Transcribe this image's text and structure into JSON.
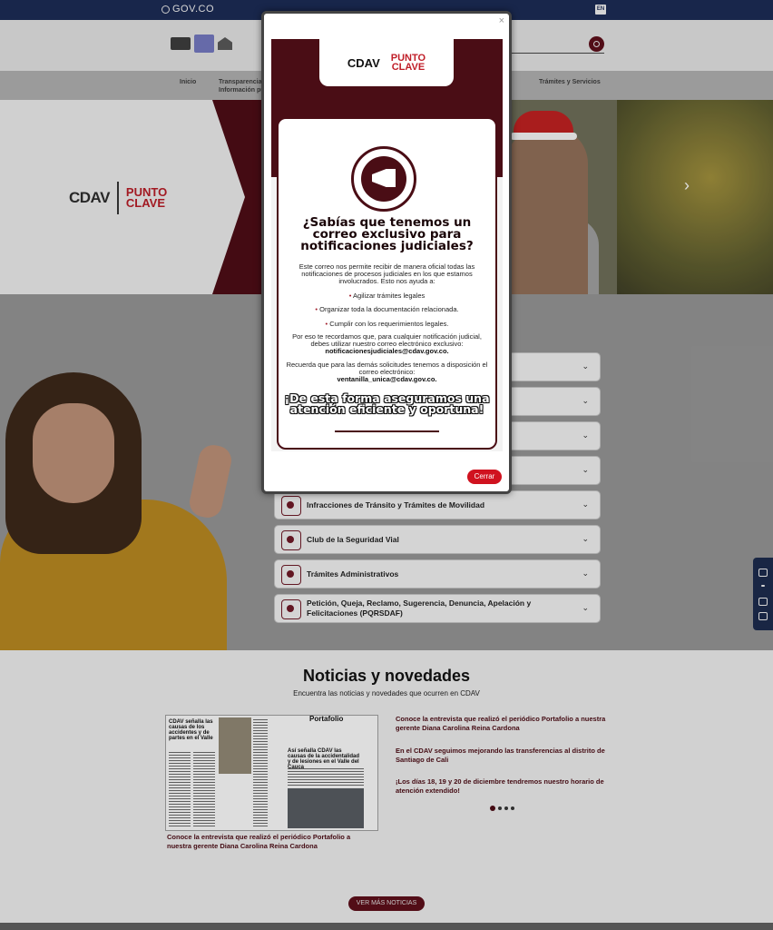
{
  "govbar": {
    "logo": "GOV.CO",
    "lang": "EN"
  },
  "nav": {
    "items": [
      {
        "label": "Inicio"
      },
      {
        "label": "Transparencia y"
      },
      {
        "label": "Información pú"
      },
      {
        "label": "Trámites y Servicios"
      }
    ]
  },
  "hero": {
    "brand_cdav": "CDAV",
    "brand_pc_1": "PUNTO",
    "brand_pc_2": "CLAVE"
  },
  "services": {
    "items": [
      {
        "label": ""
      },
      {
        "label": ""
      },
      {
        "label": ""
      },
      {
        "label": ""
      },
      {
        "label": "Infracciones de Tránsito y Trámites de Movilidad"
      },
      {
        "label": "Club de la Seguridad Vial"
      },
      {
        "label": "Trámites Administrativos"
      },
      {
        "label": "Petición, Queja, Reclamo, Sugerencia, Denuncia, Apelación y Felicitaciones (PQRSDAF)"
      }
    ]
  },
  "news": {
    "title": "Noticias y novedades",
    "subtitle": "Encuentra las noticias y novedades que ocurren en CDAV",
    "featured_caption": "Conoce la entrevista que realizó el periódico Portafolio a nuestra gerente Diana Carolina Reina Cardona",
    "paper_masthead": "Portafolio",
    "paper_headline_1": "CDAV señalla las causas de los accidentes y de partes en el Valle",
    "paper_headline_2": "Así señalla CDAV las causas de la accidentalidad y de lesiones en el Valle del Cauca",
    "links": [
      "Conoce la entrevista que realizó el periódico Portafolio a nuestra gerente Diana Carolina Reina Cardona",
      "En el CDAV seguimos mejorando las transferencias al distrito de Santiago de Cali",
      "¡Los días 18, 19 y 20 de diciembre tendremos nuestro horario de atención extendido!"
    ],
    "more_label": "VER MÁS NOTICIAS"
  },
  "modal": {
    "close_x": "×",
    "logo_cdav": "CDAV",
    "logo_pc_1": "PUNTO",
    "logo_pc_2": "CLAVE",
    "question": "¿Sabías que tenemos un correo exclusivo para notificaciones judiciales?",
    "intro": "Este correo nos permite recibir de manera oficial todas las notificaciones de procesos judiciales en los que estamos involucrados. Esto nos ayuda a:",
    "bullets": [
      "Agilizar trámites legales",
      "Organizar toda la documentación relacionada.",
      "Cumplir con los requerimientos legales."
    ],
    "reminder": "Por eso te recordamos que, para cualquier notificación judicial, debes utilizar nuestro correo electrónico exclusivo:",
    "judicial_email": "notificacionesjudiciales@cdav.gov.co.",
    "other": "Recuerda que para las demás solicitudes tenemos a disposición el correo electrónico:",
    "window_email": "ventanilla_unica@cdav.gov.co.",
    "closing": "¡De esta forma aseguramos una atención eficiente y oportuna!",
    "close_label": "Cerrar"
  },
  "colors": {
    "brand": "#4a0d15",
    "accent_red": "#d0121f",
    "govbar": "#1b2a52"
  }
}
